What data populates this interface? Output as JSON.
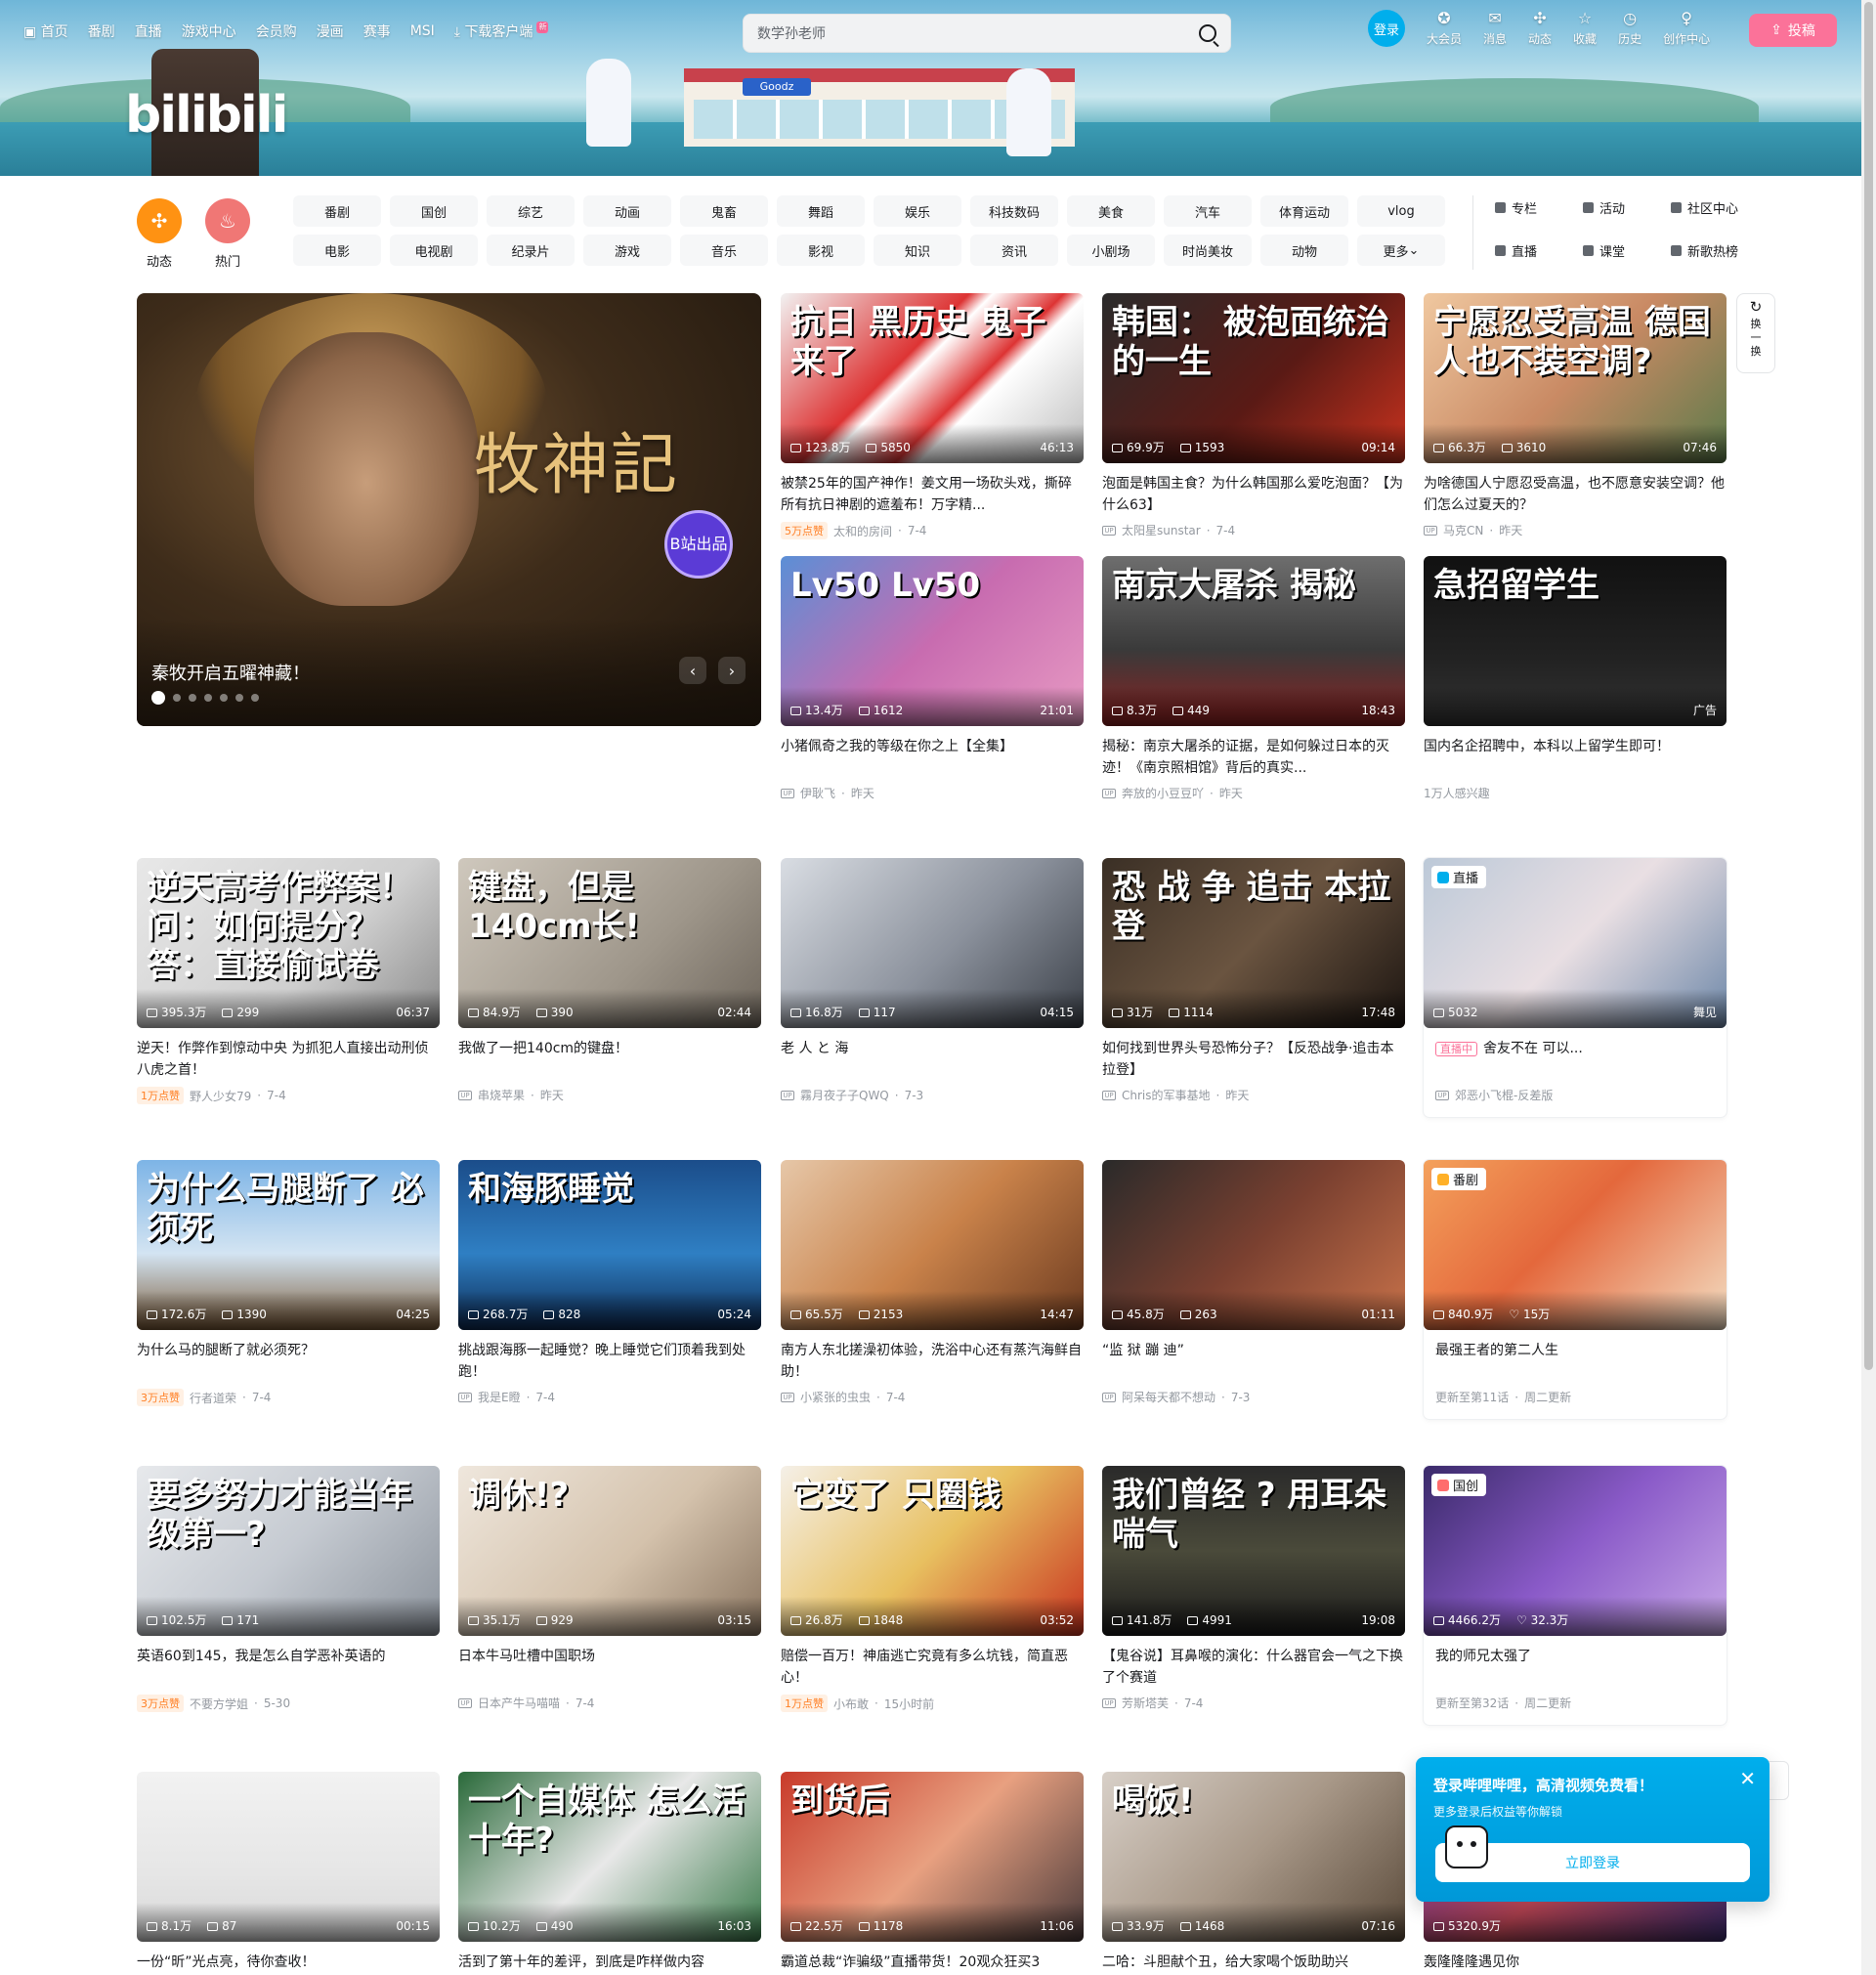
{
  "nav": {
    "left": [
      "首页",
      "番剧",
      "直播",
      "游戏中心",
      "会员购",
      "漫画",
      "赛事",
      "MSI"
    ],
    "download": "下载客户端",
    "download_badge": "新",
    "search_placeholder": "数学孙老师",
    "login": "登录",
    "right": [
      {
        "label": "大会员",
        "icon": "vip-icon"
      },
      {
        "label": "消息",
        "icon": "message-icon"
      },
      {
        "label": "动态",
        "icon": "dynamic-icon"
      },
      {
        "label": "收藏",
        "icon": "favorite-icon"
      },
      {
        "label": "历史",
        "icon": "history-icon"
      },
      {
        "label": "创作中心",
        "icon": "creator-icon"
      }
    ],
    "upload": "投稿"
  },
  "banner": {
    "logo": "bilibili",
    "store_sign": "Goodz"
  },
  "channels": {
    "dynamic": "动态",
    "hot": "热门",
    "chips": [
      "番剧",
      "国创",
      "综艺",
      "动画",
      "鬼畜",
      "舞蹈",
      "娱乐",
      "科技数码",
      "美食",
      "汽车",
      "体育运动",
      "vlog",
      "电影",
      "电视剧",
      "纪录片",
      "游戏",
      "音乐",
      "影视",
      "知识",
      "资讯",
      "小剧场",
      "时尚美妆",
      "动物",
      "更多"
    ],
    "side": [
      "专栏",
      "活动",
      "社区中心",
      "直播",
      "课堂",
      "新歌热榜"
    ],
    "dynamic_color": "#ff9212",
    "hot_color": "#f07775"
  },
  "carousel": {
    "title": "秦牧开启五曜神藏！",
    "calligraphy": "牧神記",
    "stamp": "B站出品",
    "slides": 7,
    "active": 0
  },
  "refresh": {
    "label": "换一换"
  },
  "cards": [
    {
      "thumb_text": "抗日 黑历史 鬼子来了",
      "bg": "linear-gradient(135deg,#f2f2f2 0%,#d33 40%,#fff 45%,#d33 60%,#fff 65%,#bbb 100%)",
      "views": "123.8万",
      "danmaku": "5850",
      "duration": "46:13",
      "title": "被禁25年的国产神作！姜文用一场砍头戏，撕碎所有抗日神剧的遮羞布！万字精...",
      "likes": "5万点赞",
      "author": "太和的房间",
      "date": "7-4"
    },
    {
      "thumb_text": "韩国： 被泡面统治的一生",
      "bg": "linear-gradient(135deg,#2b2b2b,#5a1a15 55%,#c8321e)",
      "views": "69.9万",
      "danmaku": "1593",
      "duration": "09:14",
      "title": "泡面是韩国主食？为什么韩国那么爱吃泡面？【为什么63】",
      "author": "太阳星sunstar",
      "date": "7-4"
    },
    {
      "thumb_text": "宁愿忍受高温 德国人也不装空调?",
      "bg": "linear-gradient(135deg,#f0c8a0,#c98a64 50%,#5b7a4a)",
      "views": "66.3万",
      "danmaku": "3610",
      "duration": "07:46",
      "title": "为啥德国人宁愿忍受高温，也不愿意安装空调？他们怎么过夏天的？",
      "author": "马克CN",
      "date": "昨天"
    },
    {
      "thumb_text": "Lv50 Lv50",
      "bg": "linear-gradient(135deg,#5b8fd6,#c86cb0 50%,#e79ac3)",
      "views": "13.4万",
      "danmaku": "1612",
      "duration": "21:01",
      "title": "小猪佩奇之我的等级在你之上【全集】",
      "author": "伊耿飞",
      "date": "昨天"
    },
    {
      "thumb_text": "南京大屠杀 揭秘",
      "bg": "linear-gradient(180deg,#6e6e6e,#3a3a3a 55%,#8a2020)",
      "views": "8.3万",
      "danmaku": "449",
      "duration": "18:43",
      "title": "揭秘：南京大屠杀的证据，是如何躲过日本的灭迹！《南京照相馆》背后的真实...",
      "author": "奔放的小豆豆吖",
      "date": "昨天"
    },
    {
      "thumb_text": "急招留学生",
      "bg": "linear-gradient(180deg,#111,#222 60%,#333)",
      "ad": "广告",
      "title": "国内名企招聘中，本科以上留学生即可！",
      "interest": "1万人感兴趣"
    },
    {
      "thumb_text": "逆天高考作弊案！ 问：如何提分？ 答：直接偷试卷",
      "bg": "linear-gradient(135deg,#e8e8e8,#cfcfcf 60%,#8a8a8a)",
      "views": "395.3万",
      "danmaku": "299",
      "duration": "06:37",
      "title": "逆天！作弊作到惊动中央 为抓犯人直接出动刑侦八虎之首！",
      "likes": "1万点赞",
      "author": "野人少女79",
      "date": "7-4"
    },
    {
      "thumb_text": "键盘，但是140cm长!",
      "bg": "linear-gradient(135deg,#cfc8bd,#9e968a 60%,#6e665c)",
      "views": "84.9万",
      "danmaku": "390",
      "duration": "02:44",
      "title": "我做了一把140cm的键盘！",
      "author": "串烧苹果",
      "date": "昨天"
    },
    {
      "thumb_text": "",
      "bg": "linear-gradient(135deg,#d9dde3,#8b919c 55%,#3a3f47)",
      "views": "16.8万",
      "danmaku": "117",
      "duration": "04:15",
      "title": "老 人 と 海",
      "author": "霧月夜子子QWQ",
      "date": "7-3"
    },
    {
      "thumb_text": "恐 战 争 追击 本拉登",
      "bg": "linear-gradient(135deg,#3a2f25,#6a5440 50%,#1b1410)",
      "views": "31万",
      "danmaku": "1114",
      "duration": "17:48",
      "title": "如何找到世界头号恐怖分子？【反恐战争·追击本拉登】",
      "author": "Chris的军事基地",
      "date": "昨天"
    },
    {
      "tag": "直播",
      "tag_color": "#00aeec",
      "thumb_text": "",
      "bg": "linear-gradient(135deg,#bcc9d8,#e9dfe3 50%,#6d87a8)",
      "views": "5032",
      "corner": "舞见",
      "live_label": "直播中",
      "title": "舍友不在 可以...",
      "author": "郊恶小飞棍-反差版"
    },
    {
      "thumb_text": "为什么马腿断了 必须死",
      "bg": "linear-gradient(180deg,#7db4e6,#d3e4f2 55%,#7a5a38)",
      "views": "172.6万",
      "danmaku": "1390",
      "duration": "04:25",
      "title": "为什么马的腿断了就必须死？",
      "likes": "3万点赞",
      "author": "行者道荣",
      "date": "7-4"
    },
    {
      "thumb_text": "和海豚睡觉",
      "bg": "linear-gradient(180deg,#1b4d8a,#2f7fc3 55%,#0d2a52)",
      "views": "268.7万",
      "danmaku": "828",
      "duration": "05:24",
      "title": "挑战跟海豚一起睡觉？晚上睡觉它们顶着我到处跑！",
      "author": "我是E瞪",
      "date": "7-4"
    },
    {
      "thumb_text": "",
      "bg": "linear-gradient(135deg,#e6c7a8,#c9824a 50%,#6b3a1f)",
      "views": "65.5万",
      "danmaku": "2153",
      "duration": "14:47",
      "title": "南方人东北搓澡初体验，洗浴中心还有蒸汽海鲜自助！",
      "author": "小紧张的虫虫",
      "date": "7-4"
    },
    {
      "thumb_text": "",
      "bg": "linear-gradient(135deg,#2a2a2a,#7a4030 50%,#c8724a)",
      "views": "45.8万",
      "danmaku": "263",
      "duration": "01:11",
      "title": "“监 狱 蹦 迪”",
      "author": "阿呆每天都不想动",
      "date": "7-3"
    },
    {
      "tag": "番剧",
      "tag_color": "#ffb027",
      "thumb_text": "",
      "bg": "linear-gradient(135deg,#f4a15c,#e4683c 45%,#f3ddc2)",
      "views": "840.9万",
      "follows": "15万",
      "title": "最强王者的第二人生",
      "update": "更新至第11话",
      "schedule": "周二更新"
    },
    {
      "thumb_text": "要多努力才能当年级第一?",
      "bg": "linear-gradient(135deg,#e7e9ec,#c5cad1 50%,#8c939c)",
      "views": "102.5万",
      "danmaku": "171",
      "duration": "",
      "title": "英语60到145，我是怎么自学恶补英语的",
      "likes": "3万点赞",
      "author": "不要方学姐",
      "date": "5-30"
    },
    {
      "thumb_text": "调休!?",
      "bg": "linear-gradient(135deg,#efe7dd,#d4c2ac 55%,#8a7560)",
      "views": "35.1万",
      "danmaku": "929",
      "duration": "03:15",
      "title": "日本牛马吐槽中国职场",
      "author": "日本产牛马喵喵",
      "date": "7-4"
    },
    {
      "thumb_text": "它变了 只圈钱",
      "bg": "linear-gradient(135deg,#f5f0e8,#e8c060 50%,#c8321e)",
      "views": "26.8万",
      "danmaku": "1848",
      "duration": "03:52",
      "title": "赔偿一百万！神庙逃亡究竟有多么坑钱，简直恶心！",
      "likes": "1万点赞",
      "author": "小布敢",
      "date": "15小时前"
    },
    {
      "thumb_text": "我们曾经 ? 用耳朵喘气",
      "bg": "linear-gradient(180deg,#2a2a2a,#4a4a3a 50%,#1a1a1a)",
      "views": "141.8万",
      "danmaku": "4991",
      "duration": "19:08",
      "title": "【鬼谷说】耳鼻喉的演化：什么器官会一气之下换了个赛道",
      "author": "芳斯塔芙",
      "date": "7-4"
    },
    {
      "tag": "国创",
      "tag_color": "#ff6d6d",
      "thumb_text": "",
      "bg": "linear-gradient(135deg,#3a2a6a,#8a5ac8 50%,#c8a8e8)",
      "views": "4466.2万",
      "follows": "32.3万",
      "title": "我的师兄太强了",
      "update": "更新至第32话",
      "schedule": "周二更新"
    },
    {
      "thumb_text": "",
      "bg": "linear-gradient(180deg,#f2f2f2,#e6e6e6 60%,#d8d8d8)",
      "views": "8.1万",
      "danmaku": "87",
      "duration": "00:15",
      "title": "一份“昕”光点亮，待你查收！"
    },
    {
      "thumb_text": "一个自媒体 怎么活十年?",
      "bg": "linear-gradient(135deg,#2a6a3a,#e8e8e8 50%,#3a7a4a)",
      "views": "10.2万",
      "danmaku": "490",
      "duration": "16:03",
      "title": "活到了第十年的差评，到底是咋样做内容"
    },
    {
      "thumb_text": "到货后",
      "bg": "linear-gradient(135deg,#c83a2a,#e8a080 50%,#4a3a3a)",
      "views": "22.5万",
      "danmaku": "1178",
      "duration": "11:06",
      "title": "霸道总裁“诈骗级”直播带货！20观众狂买3"
    },
    {
      "thumb_text": "喝饭!",
      "bg": "linear-gradient(135deg,#d8d0c8,#a89888 50%,#5a4a3a)",
      "views": "33.9万",
      "danmaku": "1468",
      "duration": "07:16",
      "title": "二哈：斗胆献个丑，给大家喝个饭助助兴"
    },
    {
      "thumb_text": "",
      "bg": "linear-gradient(135deg,#6a3aa8,#c84a5a 50%,#3a2a6a)",
      "views": "5320.9万",
      "title": "轰隆隆隆遇见你"
    }
  ],
  "popup": {
    "title": "登录哔哩哔哩，高清视频免费看！",
    "sub": "更多登录后权益等你解锁",
    "button": "立即登录"
  }
}
